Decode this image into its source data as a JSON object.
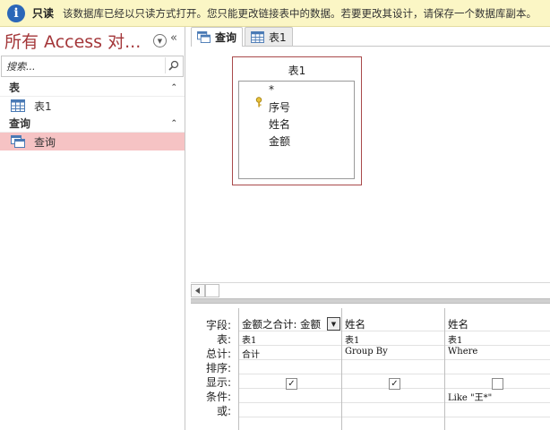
{
  "infobar": {
    "title": "只读",
    "message": "该数据库已经以只读方式打开。您只能更改链接表中的数据。若要更改其设计，请保存一个数据库副本。"
  },
  "nav": {
    "title": "所有 Access 对...",
    "search_placeholder": "搜索...",
    "groups": [
      {
        "label": "表",
        "items": [
          {
            "label": "表1",
            "icon": "table-icon"
          }
        ]
      },
      {
        "label": "查询",
        "items": [
          {
            "label": "查询",
            "icon": "query-icon",
            "selected": true
          }
        ]
      }
    ]
  },
  "tabs": [
    {
      "label": "查询",
      "icon": "query-icon",
      "active": true
    },
    {
      "label": "表1",
      "icon": "table-icon",
      "active": false
    }
  ],
  "fieldlist": {
    "title": "表1",
    "fields": [
      "*",
      "序号",
      "姓名",
      "金额"
    ]
  },
  "grid": {
    "row_labels": [
      "字段:",
      "表:",
      "总计:",
      "排序:",
      "显示:",
      "条件:",
      "或:"
    ],
    "columns": [
      {
        "field": "金额之合计: 金额",
        "table": "表1",
        "total": "合计",
        "sort": "",
        "show": true,
        "criteria": "",
        "or": ""
      },
      {
        "field": "姓名",
        "table": "表1",
        "total": "Group By",
        "sort": "",
        "show": true,
        "criteria": "",
        "or": ""
      },
      {
        "field": "姓名",
        "table": "表1",
        "total": "Where",
        "sort": "",
        "show": false,
        "criteria": "Like \"王*\"",
        "or": ""
      }
    ]
  },
  "colors": {
    "infobar_bg": "#fbf6c5",
    "info_icon": "#2b67b8",
    "nav_title": "#a4373a",
    "selected_item": "#f6c3c4",
    "fieldlist_border": "#a94a4b"
  }
}
